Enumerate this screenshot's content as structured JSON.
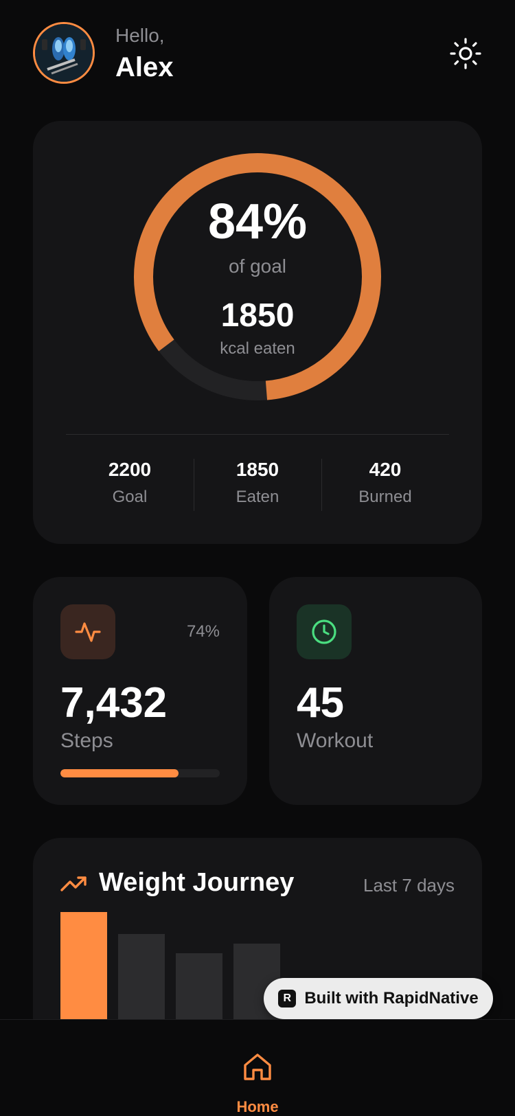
{
  "header": {
    "greeting": "Hello,",
    "user_name": "Alex",
    "avatar_icon": "profile-photo-sneakers",
    "theme_icon": "sun-icon"
  },
  "calories": {
    "percent_label": "84%",
    "percent_value": 0.84,
    "percent_caption": "of goal",
    "eaten_value": "1850",
    "eaten_caption": "kcal eaten",
    "stats": [
      {
        "value": "2200",
        "label": "Goal"
      },
      {
        "value": "1850",
        "label": "Eaten"
      },
      {
        "value": "420",
        "label": "Burned"
      }
    ],
    "ring_color": "#e07f3e",
    "track_color": "#222224"
  },
  "steps": {
    "icon": "activity-pulse-icon",
    "percent_label": "74%",
    "progress": 0.74,
    "value": "7,432",
    "label": "Steps"
  },
  "workout": {
    "icon": "clock-icon",
    "value": "45",
    "label": "Workout"
  },
  "weight": {
    "icon": "trending-up-icon",
    "title": "Weight Journey",
    "range_label": "Last 7 days",
    "bar_levels": [
      1.0,
      0.8,
      0.62,
      0.71
    ],
    "highlight_index": 0
  },
  "badge": {
    "logo_letter": "R",
    "label": "Built with RapidNative"
  },
  "tabbar": {
    "items": [
      {
        "label": "Home",
        "icon": "home-icon",
        "active": true
      }
    ]
  },
  "colors": {
    "accent": "#ff8c42",
    "green": "#4ade80",
    "card": "#151517",
    "background": "#0a0a0b"
  }
}
